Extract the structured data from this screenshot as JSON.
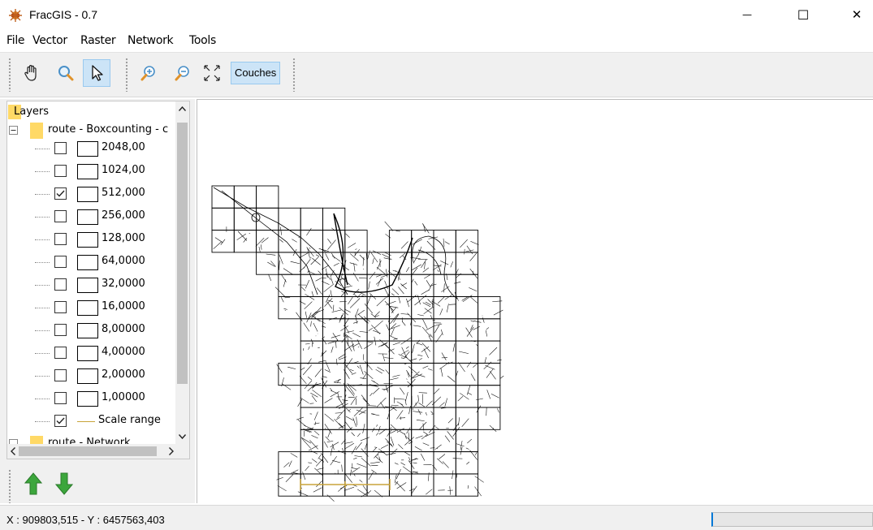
{
  "window": {
    "title": "FracGIS - 0.7",
    "minimize_glyph": "—",
    "maximize_glyph": "☐",
    "close_glyph": "✕"
  },
  "menu": [
    "File",
    "Vector",
    "Raster",
    "Network",
    "Tools"
  ],
  "toolbar": {
    "tools": [
      "pan-hand-icon",
      "zoom-rect-icon",
      "select-arrow-icon",
      "zoom-in-icon",
      "zoom-out-icon",
      "full-extent-icon"
    ],
    "active_tool": "select-arrow-icon",
    "couches_label": "Couches"
  },
  "layers": {
    "root_label": "Layers",
    "group_label": "route - Boxcounting - c",
    "items": [
      {
        "label": "2048,00",
        "checked": false
      },
      {
        "label": "1024,00",
        "checked": false
      },
      {
        "label": "512,000",
        "checked": true
      },
      {
        "label": "256,000",
        "checked": false
      },
      {
        "label": "128,000",
        "checked": false
      },
      {
        "label": "64,0000",
        "checked": false
      },
      {
        "label": "32,0000",
        "checked": false
      },
      {
        "label": "16,0000",
        "checked": false
      },
      {
        "label": "8,00000",
        "checked": false
      },
      {
        "label": "4,00000",
        "checked": false
      },
      {
        "label": "2,00000",
        "checked": false
      },
      {
        "label": "1,00000",
        "checked": false
      }
    ],
    "scale_range": {
      "label": "Scale range",
      "checked": true
    },
    "next_group_label": "route - Network"
  },
  "layer_order_buttons": [
    "move-up-arrow-icon",
    "move-down-arrow-icon"
  ],
  "status": {
    "coords": "X : 909803,515 - Y : 6457563,403"
  },
  "colors": {
    "accent": "#0078d7",
    "active_button": "#cce4f7",
    "scale_bar": "#c8a43a",
    "arrow_green": "#3ca63c"
  }
}
